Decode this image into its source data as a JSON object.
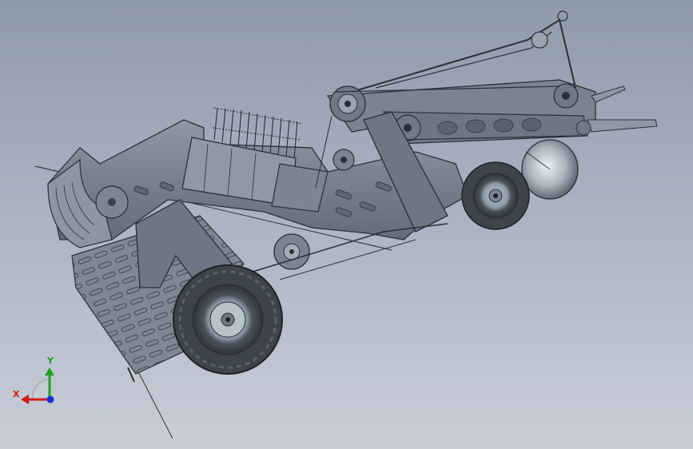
{
  "viewport": {
    "background_top": "#8e99ab",
    "background_bottom": "#c9ced8",
    "model": {
      "body_color": "#6f7a87",
      "body_light": "#8e98a4",
      "edge_color": "#2a2f36",
      "tire_color": "#3e444b",
      "rim_color": "#aab8c2",
      "cone_color": "#b9c1c9"
    }
  },
  "triad": {
    "x_label": "X",
    "y_label": "Y",
    "x_color": "#d11a1a",
    "y_color": "#19a419",
    "z_color": "#1a2fd6"
  }
}
